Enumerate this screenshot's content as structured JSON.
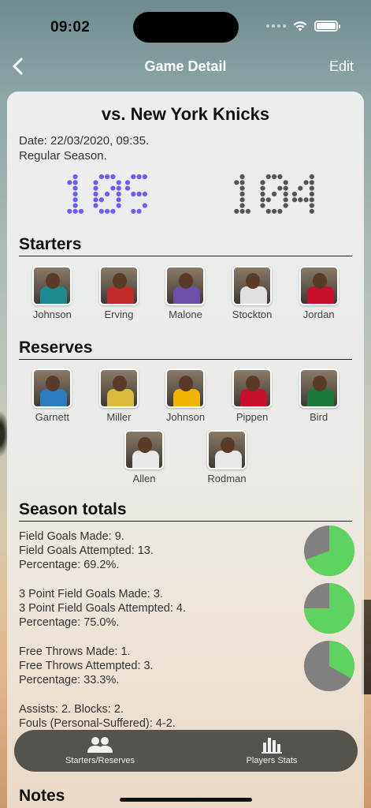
{
  "status": {
    "time": "09:02"
  },
  "nav": {
    "title": "Game Detail",
    "edit_label": "Edit"
  },
  "game": {
    "title": "vs. New York Knicks",
    "date": "Date: 22/03/2020, 09:35.",
    "season_type": "Regular Season.",
    "score_home": "109",
    "score_away": "104",
    "score_home_color": "#6b5cff",
    "score_away_color": "#555555"
  },
  "starters": {
    "title": "Starters",
    "players": [
      {
        "name": "Johnson",
        "jersey": "#1c8a8e"
      },
      {
        "name": "Erving",
        "jersey": "#c22a2a"
      },
      {
        "name": "Malone",
        "jersey": "#6b4fa8"
      },
      {
        "name": "Stockton",
        "jersey": "#e0e0e0"
      },
      {
        "name": "Jordan",
        "jersey": "#c8102e"
      }
    ]
  },
  "reserves": {
    "title": "Reserves",
    "players": [
      {
        "name": "Garnett",
        "jersey": "#2b7bbf"
      },
      {
        "name": "Miller",
        "jersey": "#d8b93a"
      },
      {
        "name": "Johnson",
        "jersey": "#f0b400"
      },
      {
        "name": "Pippen",
        "jersey": "#c8102e"
      },
      {
        "name": "Bird",
        "jersey": "#1a7a3c"
      },
      {
        "name": "Allen",
        "jersey": "#e8e8e8"
      },
      {
        "name": "Rodman",
        "jersey": "#e8e8e8"
      }
    ]
  },
  "season_totals": {
    "title": "Season totals",
    "field_goals": {
      "made": "Field Goals Made: 9.",
      "attempted": "Field Goals Attempted: 13.",
      "percentage": "Percentage: 69.2%.",
      "fraction": 0.692
    },
    "three_point": {
      "made": "3 Point Field Goals Made: 3.",
      "attempted": "3 Point Field Goals Attempted: 4.",
      "percentage": "Percentage: 75.0%.",
      "fraction": 0.75
    },
    "free_throws": {
      "made": "Free Throws Made: 1.",
      "attempted": "Free Throws Attempted: 3.",
      "percentage": "Percentage: 33.3%.",
      "fraction": 0.333
    },
    "assists_blocks": "Assists: 2. Blocks: 2.",
    "fouls": "Fouls (Personal-Suffered): 4-2.",
    "pie_made_color": "#5fd35f",
    "pie_missed_color": "#808080"
  },
  "notes": {
    "title": "Notes"
  },
  "tabbar": {
    "tab1_label": "Starters/Reserves",
    "tab2_label": "Players Stats"
  }
}
